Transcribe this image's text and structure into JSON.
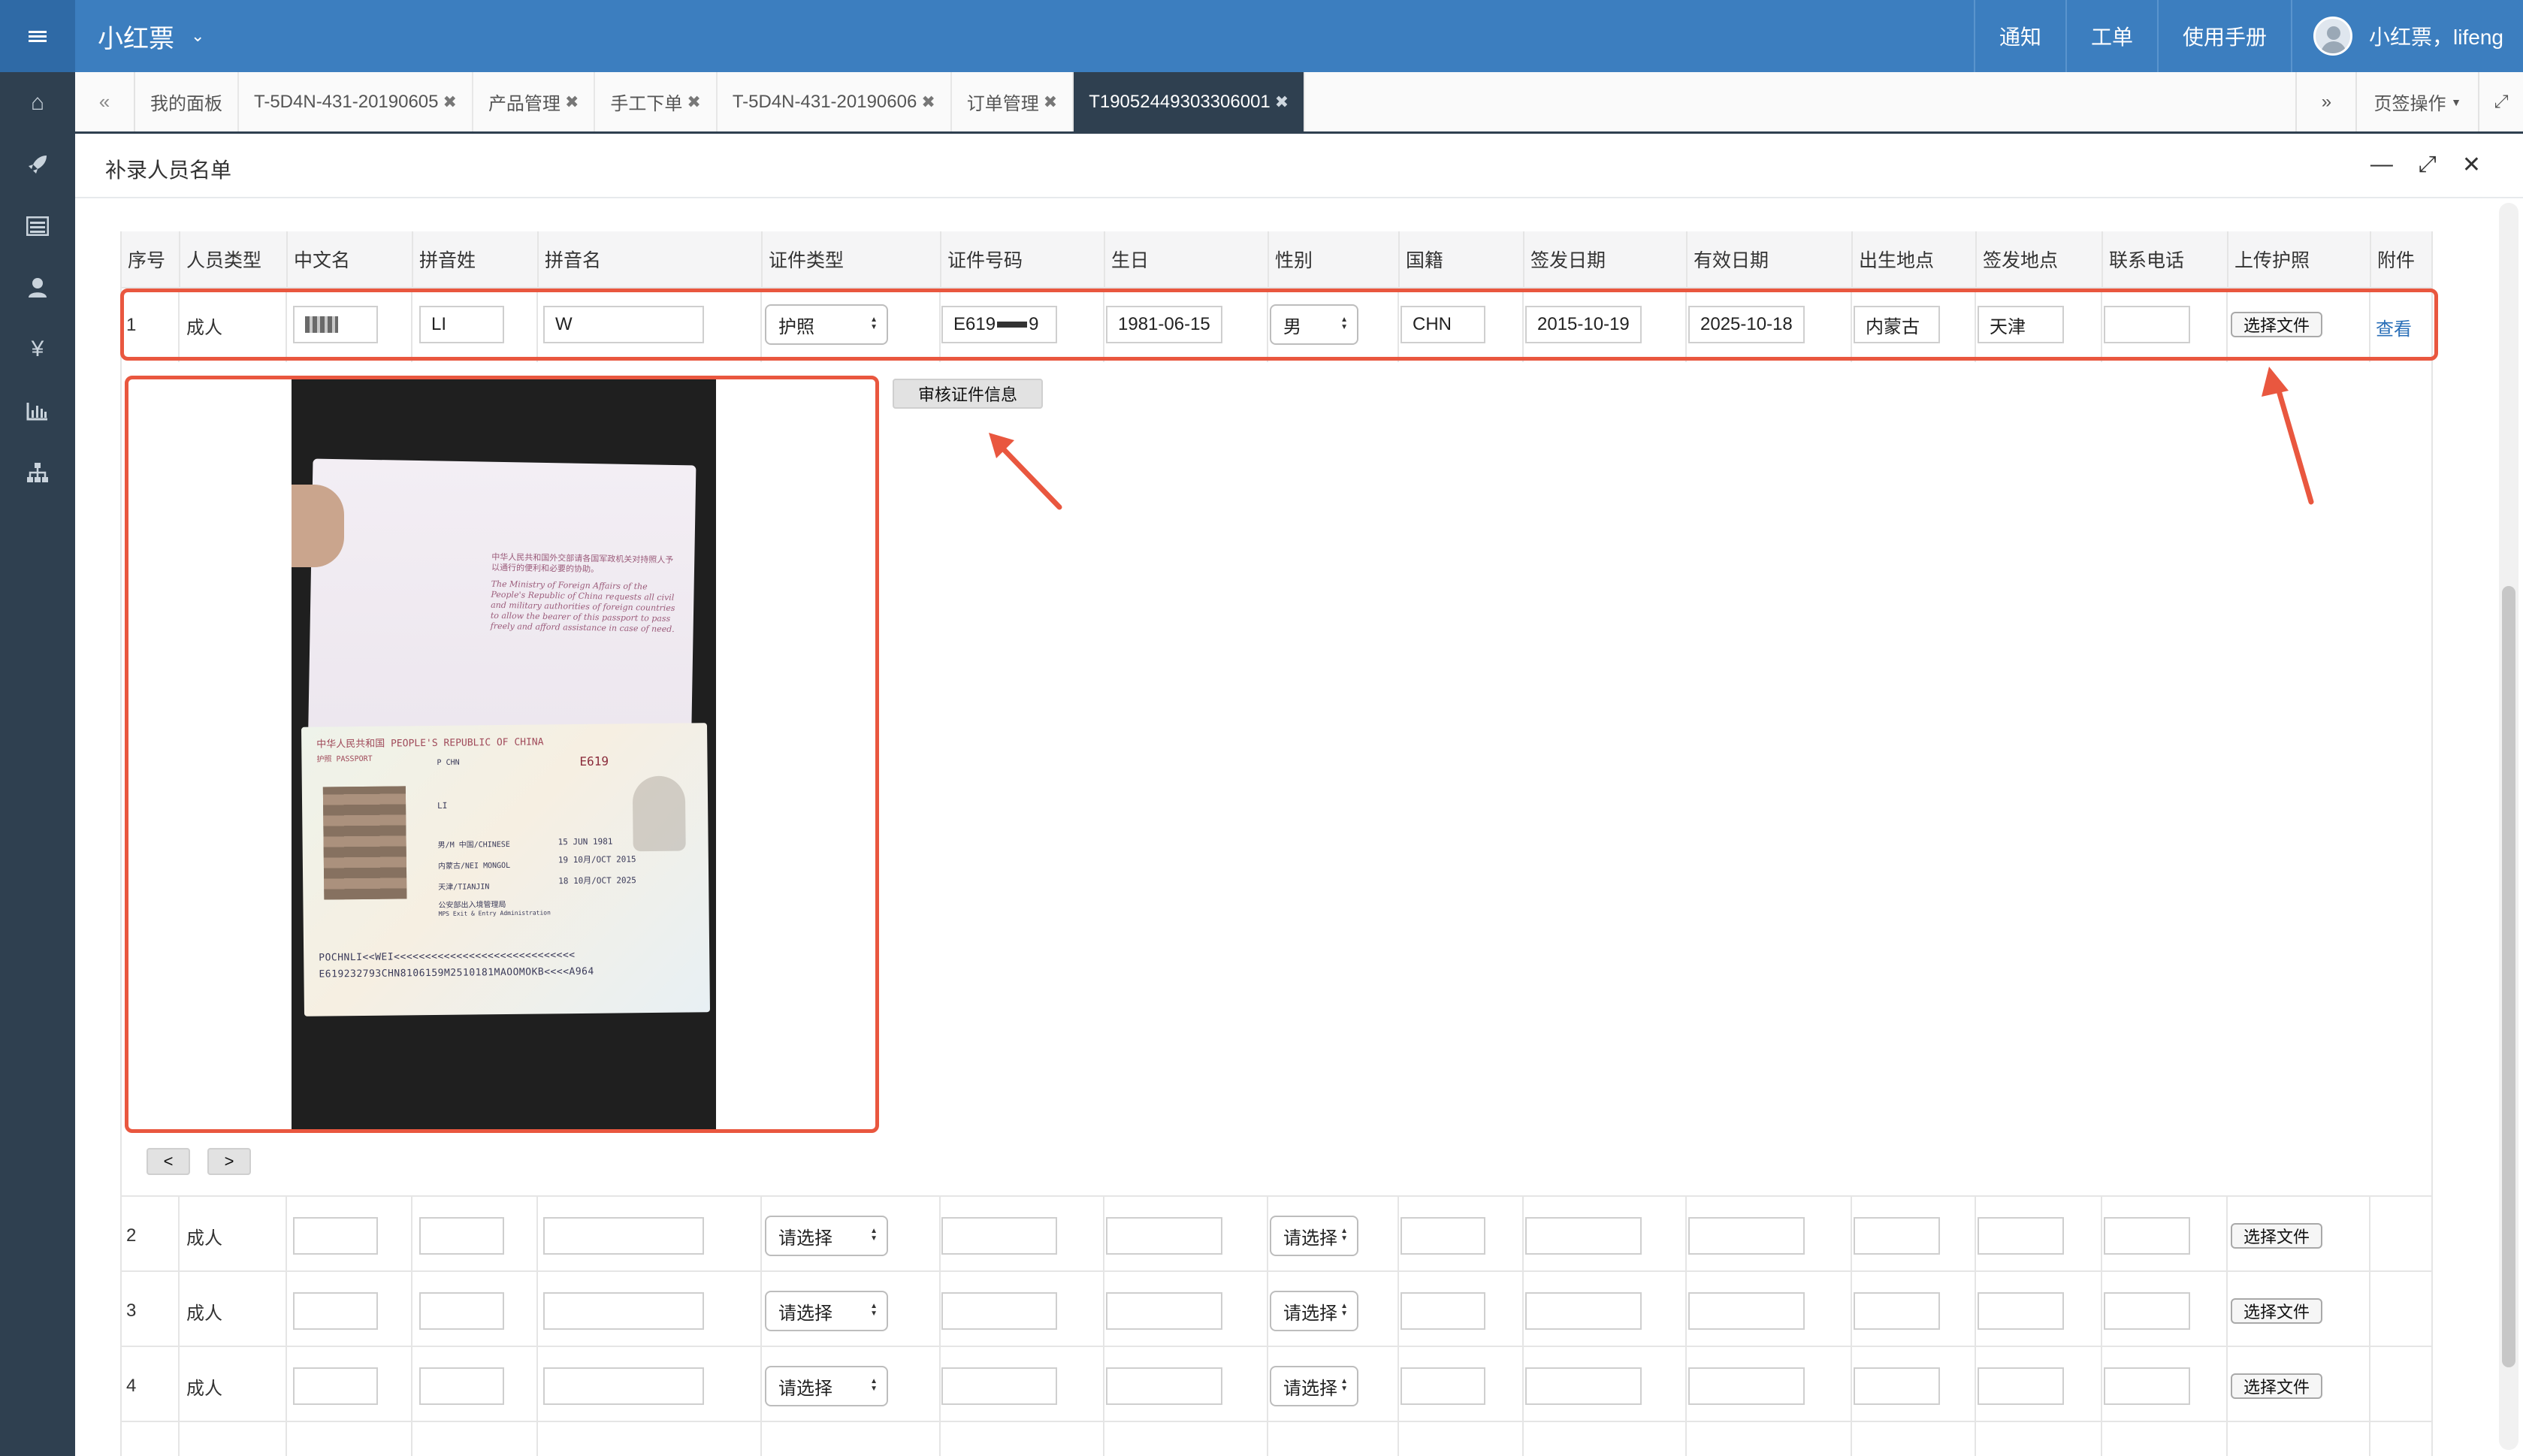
{
  "header": {
    "app_name": "小红票",
    "links": [
      "通知",
      "工单",
      "使用手册"
    ],
    "user_label": "小红票，lifeng"
  },
  "sidebar": {
    "icons": [
      "home-icon",
      "rocket-icon",
      "list-icon",
      "user-icon",
      "yen-icon",
      "bar-chart-icon",
      "sitemap-icon"
    ]
  },
  "tabs": [
    {
      "label": "我的面板",
      "closable": false,
      "active": false
    },
    {
      "label": "T-5D4N-431-20190605",
      "closable": true,
      "active": false
    },
    {
      "label": "产品管理",
      "closable": true,
      "active": false
    },
    {
      "label": "手工下单",
      "closable": true,
      "active": false
    },
    {
      "label": "T-5D4N-431-20190606",
      "closable": true,
      "active": false
    },
    {
      "label": "订单管理",
      "closable": true,
      "active": false
    },
    {
      "label": "T19052449303306001",
      "closable": true,
      "active": true
    }
  ],
  "tab_controls": {
    "page_ops": "页签操作"
  },
  "panel": {
    "title": "补录人员名单"
  },
  "table": {
    "columns": [
      "序号",
      "人员类型",
      "中文名",
      "拼音姓",
      "拼音名",
      "证件类型",
      "证件号码",
      "生日",
      "性别",
      "国籍",
      "签发日期",
      "有效日期",
      "出生地点",
      "签发地点",
      "联系电话",
      "上传护照",
      "附件"
    ],
    "rows": [
      {
        "no": "1",
        "type": "成人",
        "cn_name": "",
        "py_last": "LI",
        "py_first": "W",
        "id_type": "护照",
        "id_no": "E619",
        "id_no_tail": "9",
        "birthday": "1981-06-15",
        "gender": "男",
        "nationality": "CHN",
        "issue_date": "2015-10-19",
        "expiry_date": "2025-10-18",
        "birth_place": "内蒙古",
        "issue_place": "天津",
        "phone": "",
        "upload": "选择文件",
        "attachment": "查看"
      },
      {
        "no": "2",
        "type": "成人",
        "id_type": "请选择",
        "gender": "请选择",
        "upload": "选择文件"
      },
      {
        "no": "3",
        "type": "成人",
        "id_type": "请选择",
        "gender": "请选择",
        "upload": "选择文件"
      },
      {
        "no": "4",
        "type": "成人",
        "id_type": "请选择",
        "gender": "请选择",
        "upload": "选择文件"
      }
    ]
  },
  "preview": {
    "audit_button": "审核证件信息",
    "prev": "<",
    "next": ">",
    "passport": {
      "header": "中华人民共和国  PEOPLE'S REPUBLIC OF CHINA",
      "cover_word": "护照 PASSPORT",
      "type_code": "P   CHN",
      "passport_no": "E619",
      "surname": "LI",
      "sex_nationality": "男/M   中国/CHINESE",
      "birth_date": "15 JUN 1981",
      "birth_place": "内蒙古/NEI MONGOL",
      "issue_date": "19 10月/OCT 2015",
      "issue_place": "天津/TIANJIN",
      "expiry_date": "18 10月/OCT 2025",
      "authority": "公安部出入境管理局",
      "authority_en": "MPS Exit & Entry Administration",
      "mrz1": "POCHNLI<<WEI<<<<<<<<<<<<<<<<<<<<<<<<<<<<<",
      "mrz2": "E619232793CHN8106159M2510181MAOOMOKB<<<<A964",
      "page1_cn": "中华人民共和国外交部请各国军政机关对持照人予以通行的便利和必要的协助。",
      "page1_en": "The Ministry of Foreign Affairs of the People's Republic of China requests all civil and military authorities of foreign countries to allow the bearer of this passport to pass freely and afford assistance in case of need."
    }
  },
  "colors": {
    "header": "#3c7ebf",
    "sidebar": "#2f4050",
    "highlight": "#e9573f",
    "link": "#2a6fb8"
  }
}
